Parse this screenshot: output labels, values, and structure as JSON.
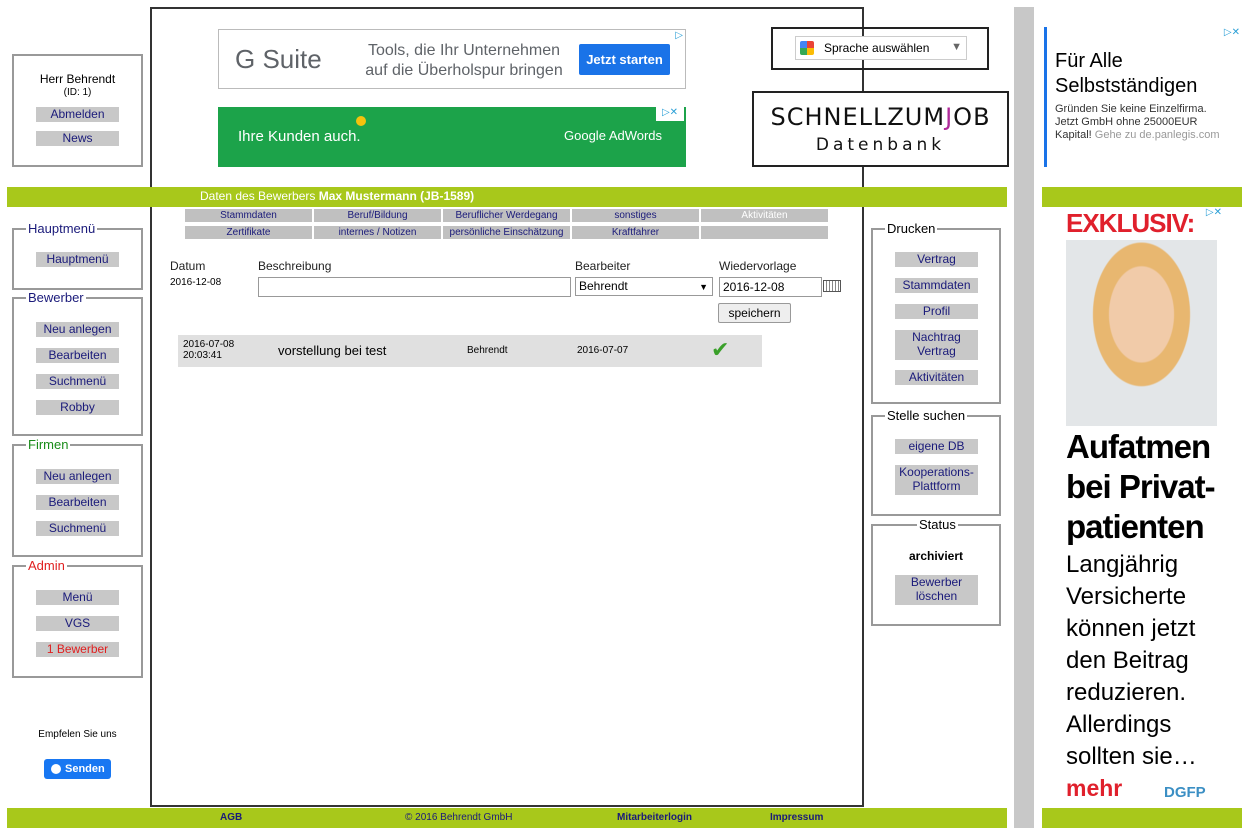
{
  "user": {
    "name": "Herr Behrendt",
    "id": "(ID: 1)",
    "logout": "Abmelden",
    "news": "News"
  },
  "left_menu": {
    "hauptmenu": {
      "legend": "Hauptmenü",
      "items": [
        "Hauptmenü"
      ]
    },
    "bewerber": {
      "legend": "Bewerber",
      "items": [
        "Neu anlegen",
        "Bearbeiten",
        "Suchmenü",
        "Robby"
      ]
    },
    "firmen": {
      "legend": "Firmen",
      "items": [
        "Neu anlegen",
        "Bearbeiten",
        "Suchmenü"
      ]
    },
    "admin": {
      "legend": "Admin",
      "items": [
        "Menü",
        "VGS",
        "1 Bewerber"
      ]
    },
    "recommend": "Empfelen Sie uns",
    "send": "Senden"
  },
  "ads": {
    "gsuite": {
      "brand": "G Suite",
      "text_line1": "Tools, die Ihr Unternehmen",
      "text_line2": "auf die Überholspur bringen",
      "cta": "Jetzt starten"
    },
    "adwords": {
      "text": "Ihre Kunden auch.",
      "brand": "Google AdWords"
    },
    "side_text": {
      "title_line1": "Für Alle",
      "title_line2": "Selbstständigen",
      "body_line1": "Gründen Sie keine Einzelfirma.",
      "body_line2": "Jetzt GmbH ohne 25000EUR",
      "body_bold": "Kapital!",
      "body_link": "Gehe zu de.panlegis.com"
    },
    "side_image": {
      "header": "EXKLUSIV:",
      "headline_1": "Aufatmen",
      "headline_2": "bei Privat-",
      "headline_3": "patienten",
      "body_1": "Langjährig",
      "body_2": "Versicherte",
      "body_3": "können jetzt",
      "body_4": "den Beitrag",
      "body_5": "reduzieren.",
      "body_6": "Allerdings",
      "body_7": "sollten sie…",
      "more": "mehr",
      "brand": "DGFP"
    }
  },
  "language": {
    "label": "Sprache auswählen"
  },
  "logo": {
    "line1_a": "SCHNELLZUM",
    "line1_b": "OB",
    "line2": "Datenbank"
  },
  "header": {
    "prefix": "Daten des Bewerbers",
    "name": "Max Mustermann (JB-1589)"
  },
  "tabs": {
    "row1": [
      "Stammdaten",
      "Beruf/Bildung",
      "Beruflicher Werdegang",
      "sonstiges",
      "Aktivitäten"
    ],
    "row2": [
      "Zertifikate",
      "internes / Notizen",
      "persönliche Einschätzung",
      "Kraftfahrer",
      ""
    ]
  },
  "form": {
    "labels": {
      "datum": "Datum",
      "beschreibung": "Beschreibung",
      "bearbeiter": "Bearbeiter",
      "wiedervorlage": "Wiedervorlage"
    },
    "datum_value": "2016-12-08",
    "beschreibung_value": "",
    "bearbeiter_value": "Behrendt",
    "wiedervorlage_value": "2016-12-08",
    "save": "speichern"
  },
  "activities": [
    {
      "date": "2016-07-08",
      "time": "20:03:41",
      "text": "vorstellung bei test",
      "user": "Behrendt",
      "due": "2016-07-07",
      "done": true
    }
  ],
  "right_menu": {
    "drucken": {
      "legend": "Drucken",
      "items": [
        "Vertrag",
        "Stammdaten",
        "Profil",
        "Nachtrag Vertrag",
        "Aktivitäten"
      ]
    },
    "stelle": {
      "legend": "Stelle suchen",
      "items": [
        "eigene DB",
        "Kooperations-Plattform"
      ]
    },
    "status": {
      "legend": "Status",
      "value": "archiviert",
      "delete": "Bewerber löschen"
    }
  },
  "footer": {
    "agb": "AGB",
    "copyright": "© 2016 Behrendt GmbH",
    "login": "Mitarbeiterlogin",
    "impressum": "Impressum"
  },
  "colors": {
    "accent_green": "#a8c81b",
    "ad_green": "#1ca34a",
    "link_blue": "#1a1a7a",
    "admin_red": "#e02020",
    "firmen_green": "#1a8c1a"
  }
}
